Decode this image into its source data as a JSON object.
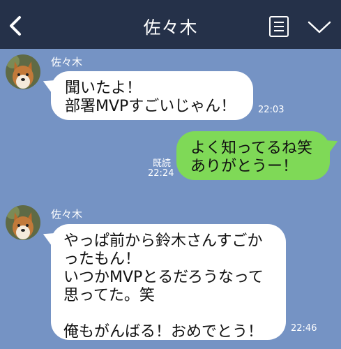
{
  "header": {
    "title": "佐々木",
    "back_icon": "chevron-left-icon",
    "menu_icon": "menu-icon",
    "dropdown_icon": "chevron-down-icon",
    "background": "#253149"
  },
  "chat": {
    "background": "#7593c4",
    "messages": [
      {
        "sender": "佐々木",
        "text": "聞いたよ！\n部署MVPすごいじゃん！",
        "time": "22:03"
      },
      {
        "sender": "me",
        "text": "よく知ってるね笑\nありがとうー！",
        "read": "既読",
        "time": "22:24",
        "bubble_color": "#7fd957"
      },
      {
        "sender": "佐々木",
        "text": "やっぱ前から鈴木さんすごかったもん！\nいつかMVPとるだろうなって思ってた。笑\n\n俺もがんばる！おめでとう！",
        "time": "22:46"
      }
    ]
  }
}
